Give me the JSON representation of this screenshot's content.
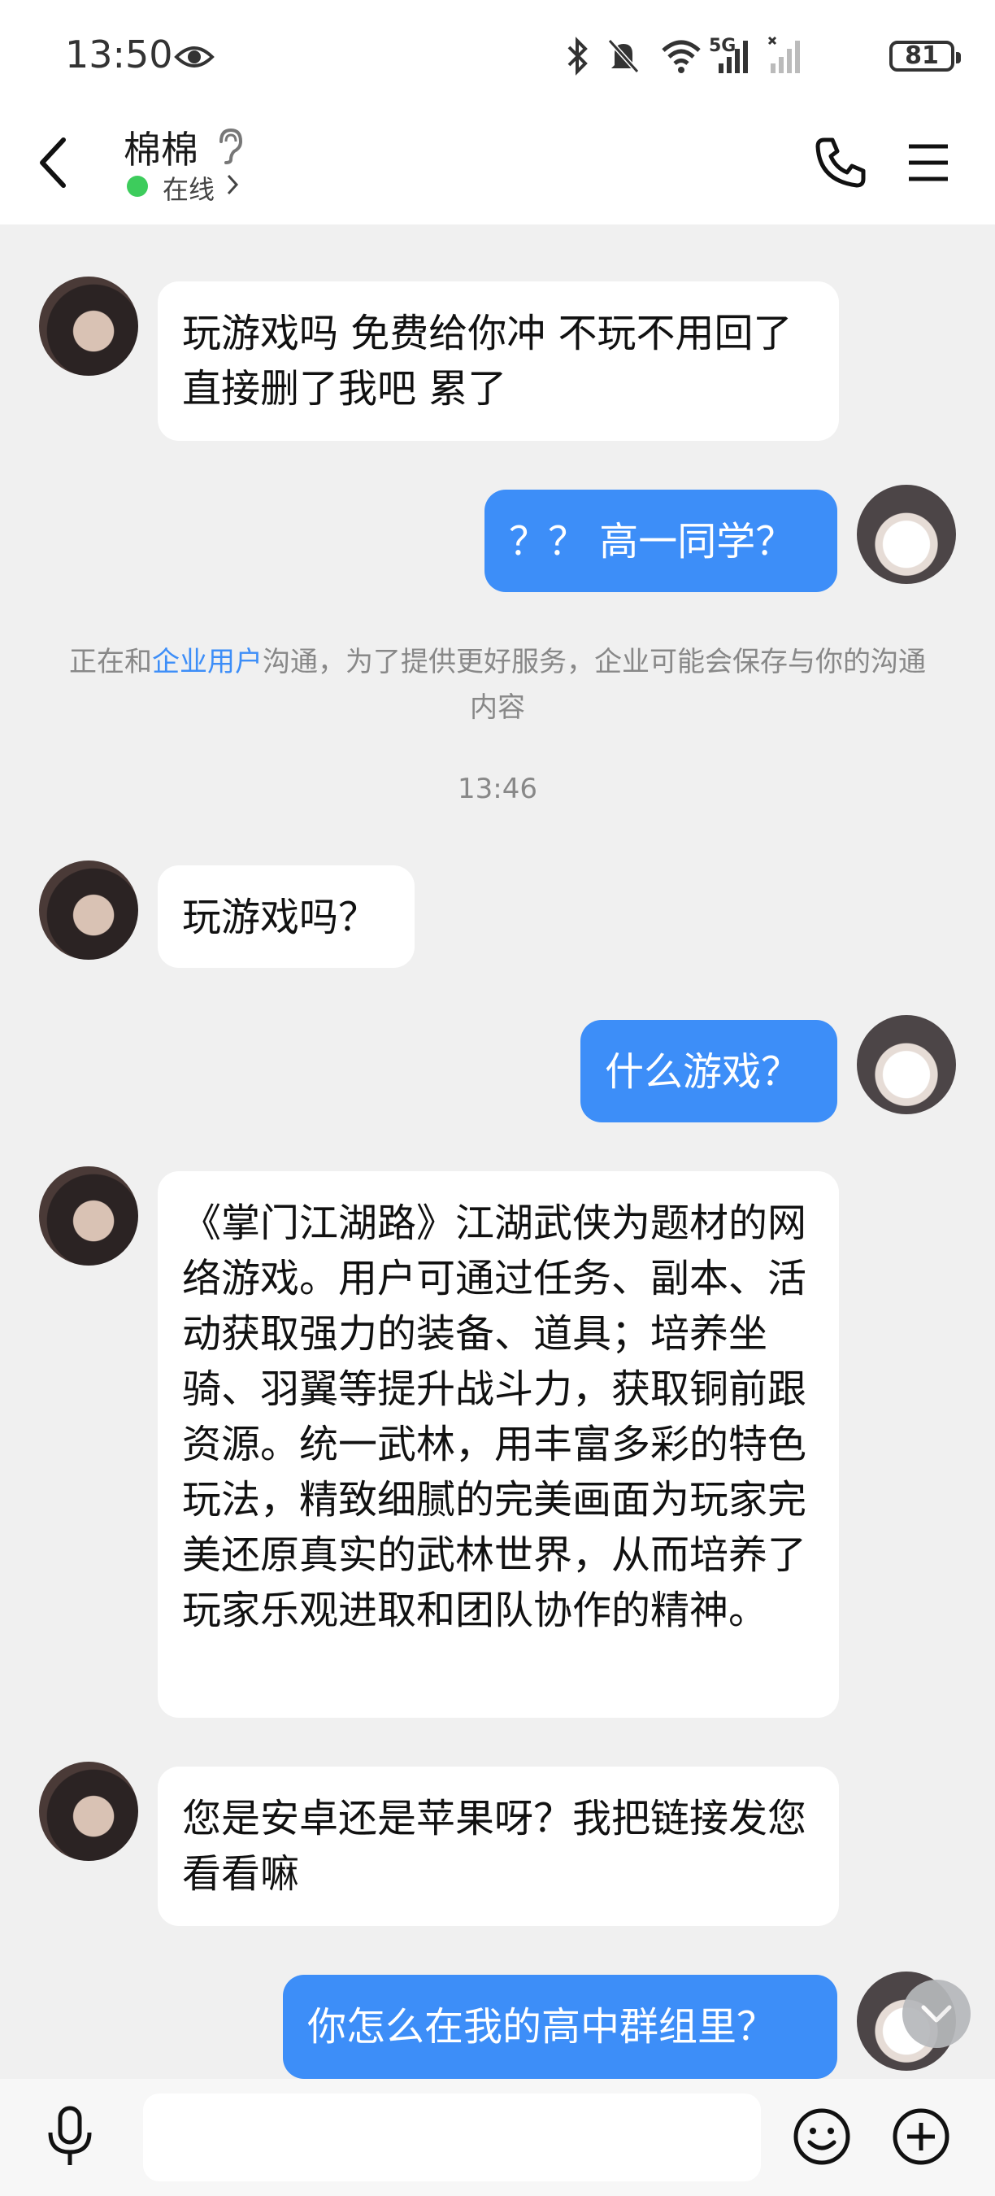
{
  "status": {
    "time": "13:50",
    "network": "5G",
    "battery": "81"
  },
  "header": {
    "contact_name": "棉棉",
    "status_text": "在线"
  },
  "messages": [
    {
      "side": "left",
      "text": "玩游戏吗 免费给你冲 不玩不用回了直接删了我吧 累了"
    },
    {
      "side": "right",
      "text": "？？ 高一同学？"
    },
    {
      "side": "left",
      "text": "玩游戏吗？"
    },
    {
      "side": "right",
      "text": "什么游戏？"
    },
    {
      "side": "left",
      "text": "《掌门江湖路》江湖武侠为题材的网络游戏。用户可通过任务、副本、活动获取强力的装备、道具；培养坐骑、羽翼等提升战斗力，获取铜前跟资源。统一武林，用丰富多彩的特色玩法，精致细腻的完美画面为玩家完美还原真实的武林世界，从而培养了玩家乐观进取和团队协作的精神。"
    },
    {
      "side": "left",
      "text": "您是安卓还是苹果呀？我把链接发您看看嘛"
    },
    {
      "side": "right",
      "text": "你怎么在我的高中群组里？"
    }
  ],
  "notice": {
    "prefix": "正在和",
    "highlight": "企业用户",
    "suffix": "沟通，为了提供更好服务，企业可能会保存与你的沟通内容"
  },
  "timestamp": "13:46",
  "input": {
    "placeholder": ""
  },
  "icons": {
    "eye": "eye-icon",
    "back": "back-arrow-icon",
    "ear": "ear-icon",
    "phone": "phone-icon",
    "menu": "menu-icon",
    "mic": "microphone-icon",
    "emoji": "emoji-icon",
    "plus": "plus-icon",
    "scroll": "chevron-down-icon"
  },
  "colors": {
    "accent": "#3d8ef8",
    "online": "#3dcc5c",
    "background": "#f0f0f0"
  }
}
